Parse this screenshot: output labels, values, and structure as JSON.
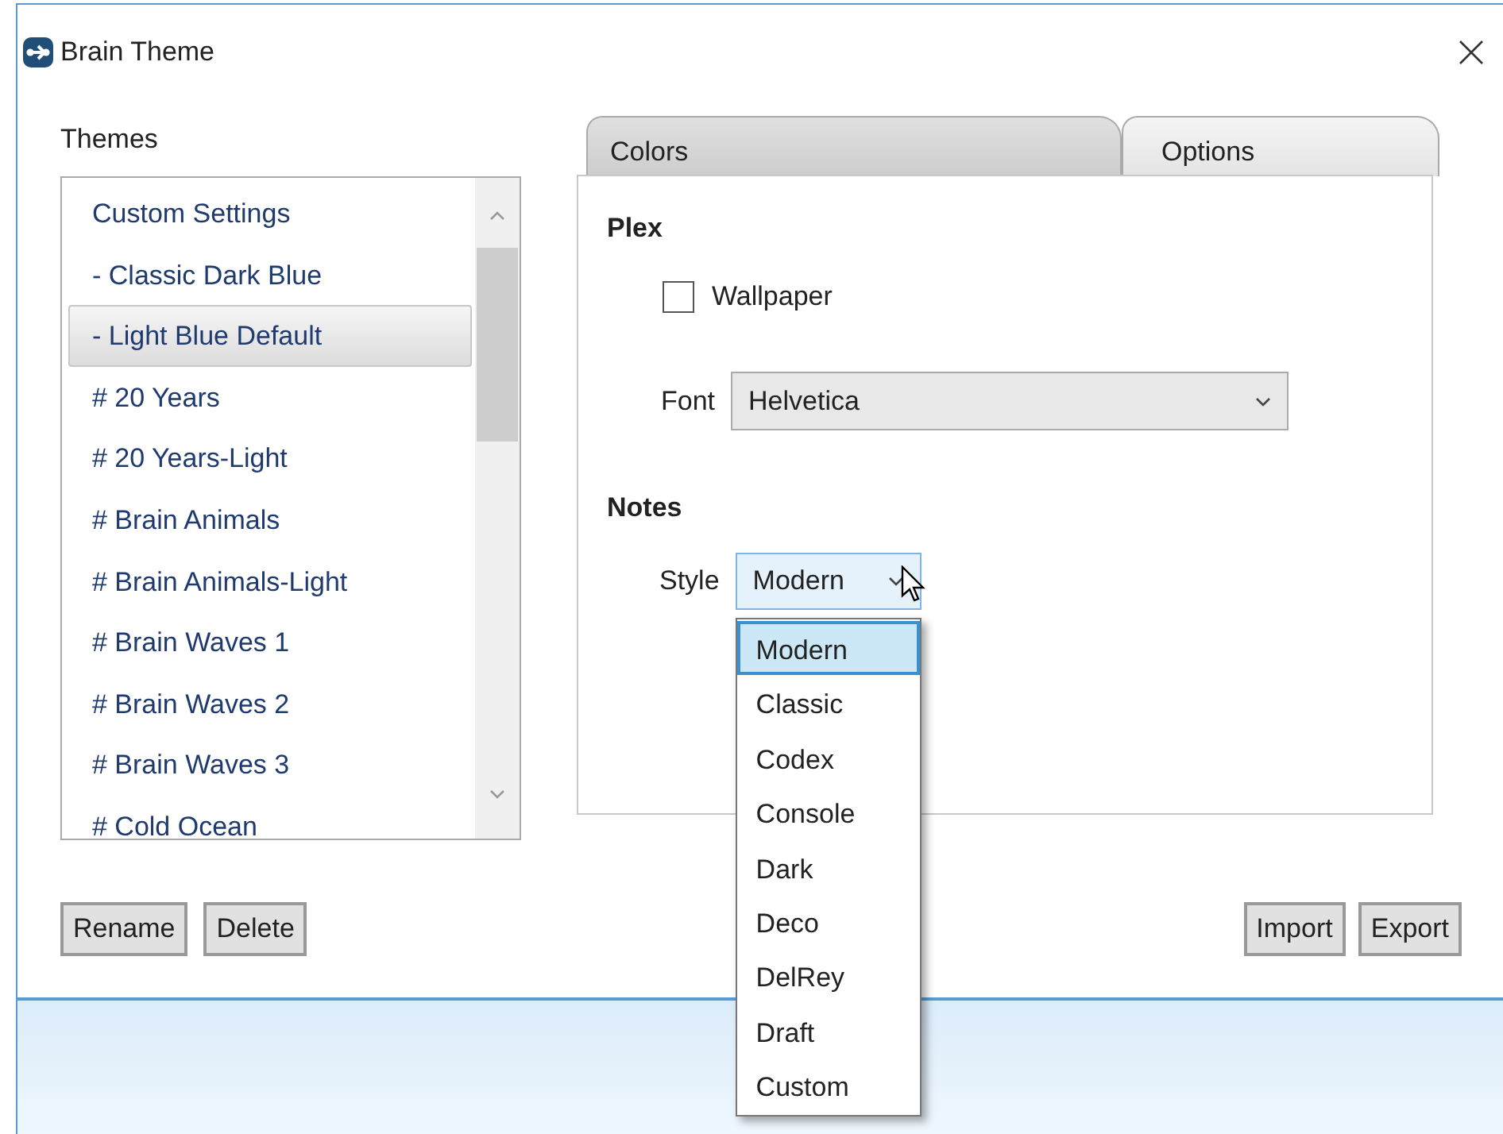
{
  "window": {
    "title": "Brain Theme"
  },
  "themes": {
    "label": "Themes",
    "items": [
      {
        "label": "Custom Settings",
        "selected": false
      },
      {
        "label": "- Classic Dark Blue",
        "selected": false
      },
      {
        "label": "- Light Blue Default",
        "selected": true
      },
      {
        "label": "# 20 Years",
        "selected": false
      },
      {
        "label": "# 20 Years-Light",
        "selected": false
      },
      {
        "label": "# Brain Animals",
        "selected": false
      },
      {
        "label": "# Brain Animals-Light",
        "selected": false
      },
      {
        "label": "# Brain Waves 1",
        "selected": false
      },
      {
        "label": "# Brain Waves 2",
        "selected": false
      },
      {
        "label": "# Brain Waves 3",
        "selected": false
      },
      {
        "label": "# Cold Ocean",
        "selected": false
      }
    ],
    "buttons": [
      "Rename",
      "Delete"
    ]
  },
  "tabs": [
    {
      "label": "Colors",
      "selected": false
    },
    {
      "label": "Options",
      "selected": true
    }
  ],
  "options": {
    "plex": {
      "heading": "Plex",
      "wallpaper": {
        "label": "Wallpaper",
        "checked": false
      },
      "font": {
        "label": "Font",
        "value": "Helvetica"
      }
    },
    "notes": {
      "heading": "Notes",
      "style": {
        "label": "Style",
        "value": "Modern",
        "expanded": true,
        "options": [
          {
            "label": "Modern",
            "selected": true
          },
          {
            "label": "Classic",
            "selected": false
          },
          {
            "label": "Codex",
            "selected": false
          },
          {
            "label": "Console",
            "selected": false
          },
          {
            "label": "Dark",
            "selected": false
          },
          {
            "label": "Deco",
            "selected": false
          },
          {
            "label": "DelRey",
            "selected": false
          },
          {
            "label": "Draft",
            "selected": false
          },
          {
            "label": "Custom",
            "selected": false
          }
        ]
      }
    }
  },
  "buttons": [
    "Import",
    "Export"
  ]
}
